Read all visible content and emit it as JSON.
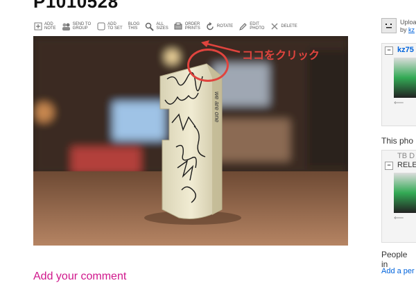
{
  "page": {
    "title": "P1010528"
  },
  "toolbar": {
    "items": [
      {
        "label": "ADD\nNOTE",
        "icon": "add-note-icon"
      },
      {
        "label": "SEND TO\nGROUP",
        "icon": "send-to-group-icon"
      },
      {
        "label": "ADD\nTO SET",
        "icon": "add-to-set-icon"
      },
      {
        "label": "BLOG\nTHIS",
        "icon": "blog-this-icon"
      },
      {
        "label": "ALL\nSIZES",
        "icon": "magnifier-icon"
      },
      {
        "label": "ORDER\nPRINTS",
        "icon": "order-prints-icon"
      },
      {
        "label": "ROTATE",
        "icon": "rotate-icon"
      },
      {
        "label": "EDIT\nPHOTO",
        "icon": "pencil-icon"
      },
      {
        "label": "DELETE",
        "icon": "delete-icon"
      }
    ]
  },
  "annotation": {
    "text": "ココをクリック",
    "color": "#e0443e"
  },
  "comment": {
    "label": "Add your comment"
  },
  "sidebar": {
    "uploader_prefix": "Uploa",
    "uploader_by": "by ",
    "uploader_name": "kz",
    "set1_title": "kz75",
    "this_photo": "This pho",
    "set2_title_line1": "TB D",
    "set2_title_line2": "RELE",
    "people": "People in",
    "add_person": "Add a per"
  },
  "colors": {
    "link": "#0063dc",
    "comment": "#d0178c",
    "annotation": "#e0443e"
  }
}
